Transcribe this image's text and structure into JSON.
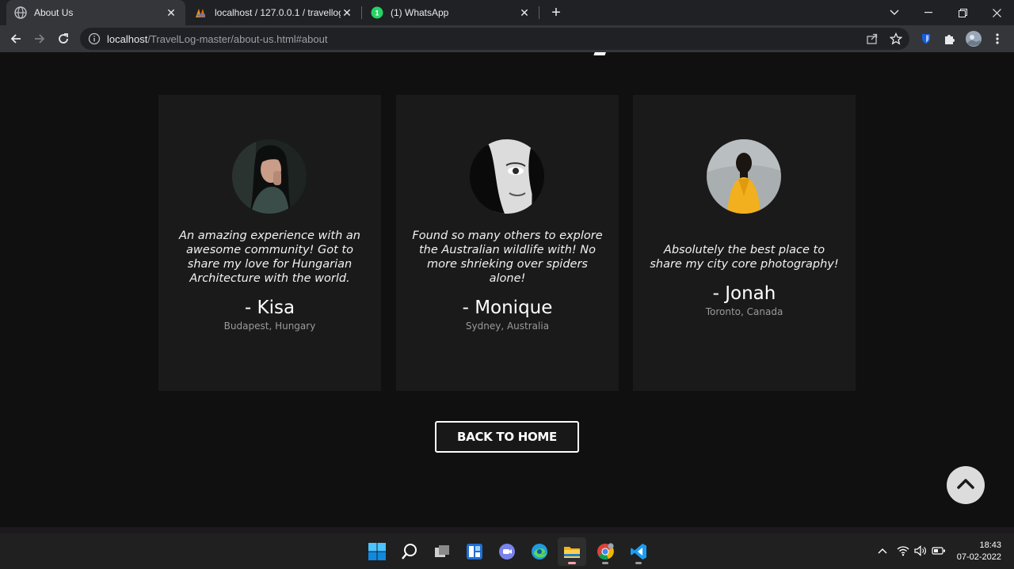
{
  "browser": {
    "tabs": [
      {
        "title": "About Us",
        "active": true,
        "icon": "globe-icon"
      },
      {
        "title": "localhost / 127.0.0.1 / travellog | ph",
        "active": false,
        "icon": "phpmyadmin-icon"
      },
      {
        "title": "(1) WhatsApp",
        "active": false,
        "icon": "whatsapp-icon"
      }
    ],
    "url": {
      "host": "localhost",
      "path": "/TravelLog-master/about-us.html#about"
    },
    "new_tab_label": "+"
  },
  "testimonials": [
    {
      "quote": "An amazing experience with an awesome community! Got to share my love for Hungarian Architecture with the world.",
      "name": "- Kisa",
      "location": "Budapest, Hungary",
      "avatar": "woman-portrait"
    },
    {
      "quote": "Found so many others to explore the Australian wildlife with! No more shrieking over spiders alone!",
      "name": "- Monique",
      "location": "Sydney, Australia",
      "avatar": "woman-bw-portrait"
    },
    {
      "quote": "Absolutely the best place to share my city core photography!",
      "name": "- Jonah",
      "location": "Toronto, Canada",
      "avatar": "man-yellow-jacket-portrait"
    }
  ],
  "back_home_label": "BACK TO HOME",
  "scroll_top_icon": "chevron-up-icon",
  "taskbar": {
    "apps": [
      "windows-start-icon",
      "search-icon",
      "task-view-icon",
      "widgets-icon",
      "teams-chat-icon",
      "edge-icon",
      "file-explorer-icon",
      "chrome-icon",
      "vscode-icon"
    ],
    "time": "18:43",
    "date": "07-02-2022"
  },
  "colors": {
    "page_bg": "#101010",
    "card_bg": "#1a1a1a",
    "chrome_dark": "#202124",
    "chrome_toolbar": "#35363a"
  }
}
